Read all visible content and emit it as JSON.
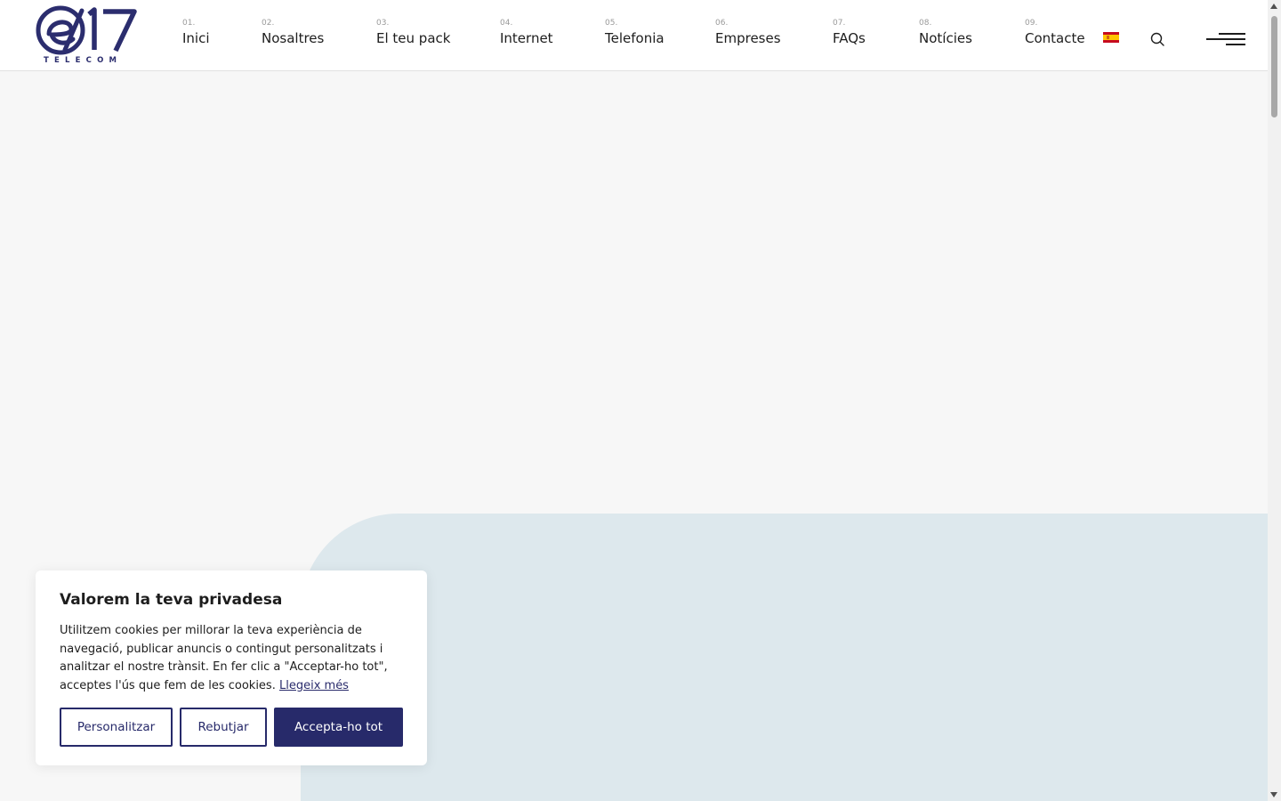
{
  "brand": {
    "logo_mark": "e17",
    "logo_subtitle": "TELECOM",
    "color": "#2b2d6e"
  },
  "nav": {
    "items": [
      {
        "num": "01.",
        "label": "Inici"
      },
      {
        "num": "02.",
        "label": "Nosaltres"
      },
      {
        "num": "03.",
        "label": "El teu pack"
      },
      {
        "num": "04.",
        "label": "Internet"
      },
      {
        "num": "05.",
        "label": "Telefonia"
      },
      {
        "num": "06.",
        "label": "Empreses"
      },
      {
        "num": "07.",
        "label": "FAQs"
      },
      {
        "num": "08.",
        "label": "Notícies"
      },
      {
        "num": "09.",
        "label": "Contacte"
      }
    ],
    "language_icon": "spain-flag-icon",
    "search_icon": "search-icon",
    "menu_icon": "hamburger-menu-icon"
  },
  "cookie": {
    "title": "Valorem la teva privadesa",
    "body": "Utilitzem cookies per millorar la teva experiència de navegació, publicar anuncis o contingut personalitzats i analitzar el nostre trànsit. En fer clic a \"Acceptar-ho tot\", acceptes l'ús que fem de les cookies.",
    "read_more": "Llegeix més",
    "buttons": {
      "customize": "Personalitzar",
      "reject": "Rebutjar",
      "accept": "Accepta-ho tot"
    }
  },
  "colors": {
    "accent": "#272a6a",
    "hero_shape": "#dde8ed",
    "page_bg": "#f7f7f7"
  }
}
